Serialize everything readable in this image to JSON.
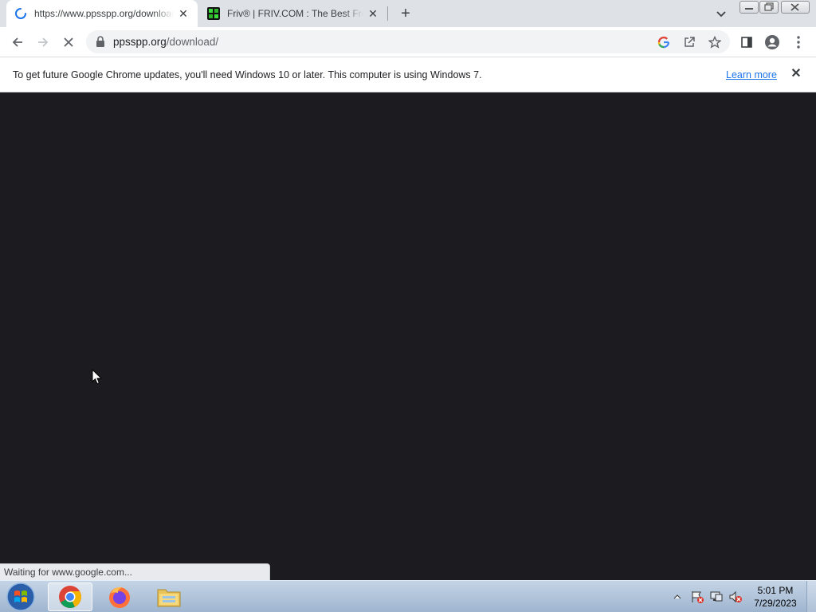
{
  "browser": {
    "tabs": [
      {
        "title": "https://www.ppsspp.org/downloads/",
        "active": true,
        "loading": true,
        "favicon": "loading-spinner-icon"
      },
      {
        "title": "Friv® | FRIV.COM : The Best Free Games",
        "active": false,
        "favicon": "friv-favicon-icon"
      }
    ],
    "newtab_label": "+",
    "close_glyph": "✕",
    "toolbar": {
      "url_host": "ppsspp.org",
      "url_path": "/download/"
    },
    "infobar": {
      "message": "To get future Google Chrome updates, you'll need Windows 10 or later. This computer is using Windows 7.",
      "link": "Learn more"
    },
    "status": "Waiting for www.google.com..."
  },
  "taskbar": {
    "apps": [
      "chrome-icon",
      "firefox-icon",
      "file-explorer-icon"
    ],
    "time": "5:01 PM",
    "date": "7/29/2023"
  },
  "colors": {
    "content_bg": "#1c1b1f",
    "tabstrip_bg": "#dee1e6",
    "link": "#1a73e8"
  }
}
